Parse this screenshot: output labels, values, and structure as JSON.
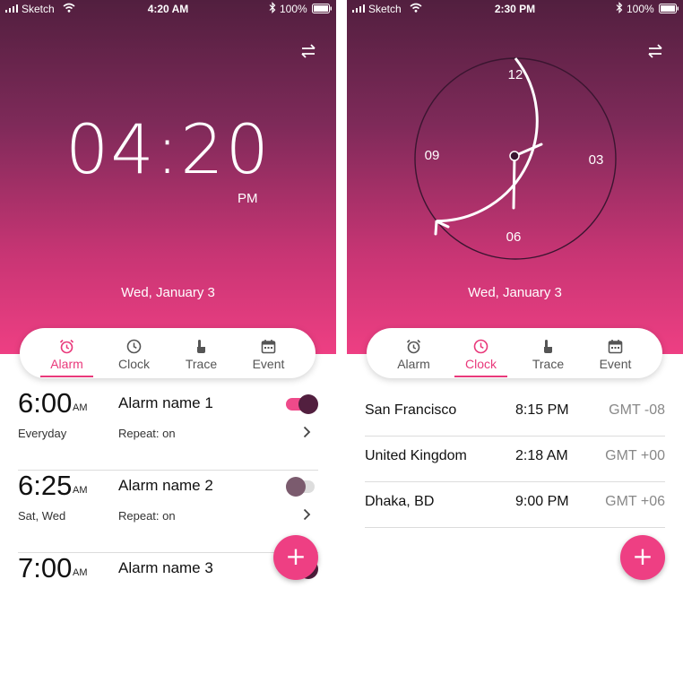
{
  "status": {
    "carrier": "Sketch",
    "battery": "100%"
  },
  "left": {
    "status_time": "4:20 AM",
    "digital_time": "04:20",
    "ampm": "PM",
    "date": "Wed, January 3",
    "tabs": [
      "Alarm",
      "Clock",
      "Trace",
      "Event"
    ],
    "active_tab": "Alarm",
    "alarms": [
      {
        "time": "6:00",
        "ampm": "AM",
        "name": "Alarm name 1",
        "days": "Everyday",
        "repeat": "Repeat: on",
        "enabled": true
      },
      {
        "time": "6:25",
        "ampm": "AM",
        "name": "Alarm name 2",
        "days": "Sat, Wed",
        "repeat": "Repeat: on",
        "enabled": false
      },
      {
        "time": "7:00",
        "ampm": "AM",
        "name": "Alarm name 3",
        "enabled": true
      }
    ],
    "fab_label": "+"
  },
  "right": {
    "status_time": "2:30 PM",
    "dial_labels": {
      "top": "12",
      "right": "03",
      "bottom": "06",
      "left": "09"
    },
    "date": "Wed, January 3",
    "tabs": [
      "Alarm",
      "Clock",
      "Trace",
      "Event"
    ],
    "active_tab": "Clock",
    "world": [
      {
        "city": "San Francisco",
        "time": "8:15 PM",
        "gmt": "GMT -08"
      },
      {
        "city": "United Kingdom",
        "time": "2:18 AM",
        "gmt": "GMT +00"
      },
      {
        "city": "Dhaka, BD",
        "time": "9:00 PM",
        "gmt": "GMT +06"
      }
    ],
    "fab_label": "+"
  },
  "icons": {
    "alarm": "alarm-clock-icon",
    "clock": "clock-icon",
    "trace": "touch-hand-icon",
    "event": "calendar-icon",
    "swap": "swap-arrows-icon",
    "add": "plus-icon"
  },
  "colors": {
    "accent": "#ee3f83",
    "dark": "#521f3f",
    "gradient_top": "#521f3f",
    "gradient_bottom": "#ee3f83"
  }
}
